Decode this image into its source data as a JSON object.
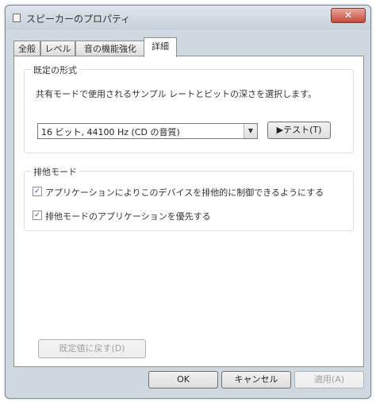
{
  "window": {
    "title": "スピーカーのプロパティ",
    "close_glyph": "✕"
  },
  "tabs": [
    {
      "label": "全般",
      "active": false
    },
    {
      "label": "レベル",
      "active": false
    },
    {
      "label": "音の機能強化",
      "active": false
    },
    {
      "label": "詳細",
      "active": true
    }
  ],
  "default_format": {
    "group_label": "既定の形式",
    "description": "共有モードで使用されるサンプル レートとビットの深さを選択します。",
    "selected_value": "16 ビット, 44100 Hz (CD の音質)",
    "dropdown_arrow": "▼",
    "test_button_label": "▶テスト(T)"
  },
  "exclusive_mode": {
    "group_label": "排他モード",
    "options": [
      {
        "label": "アプリケーションによりこのデバイスを排他的に制御できるようにする",
        "checked": true
      },
      {
        "label": "排他モードのアプリケーションを優先する",
        "checked": true
      }
    ],
    "check_glyph": "✓"
  },
  "restore_defaults_label": "既定値に戻す(D)",
  "footer": {
    "ok_label": "OK",
    "cancel_label": "キャンセル",
    "apply_label": "適用(A)"
  }
}
